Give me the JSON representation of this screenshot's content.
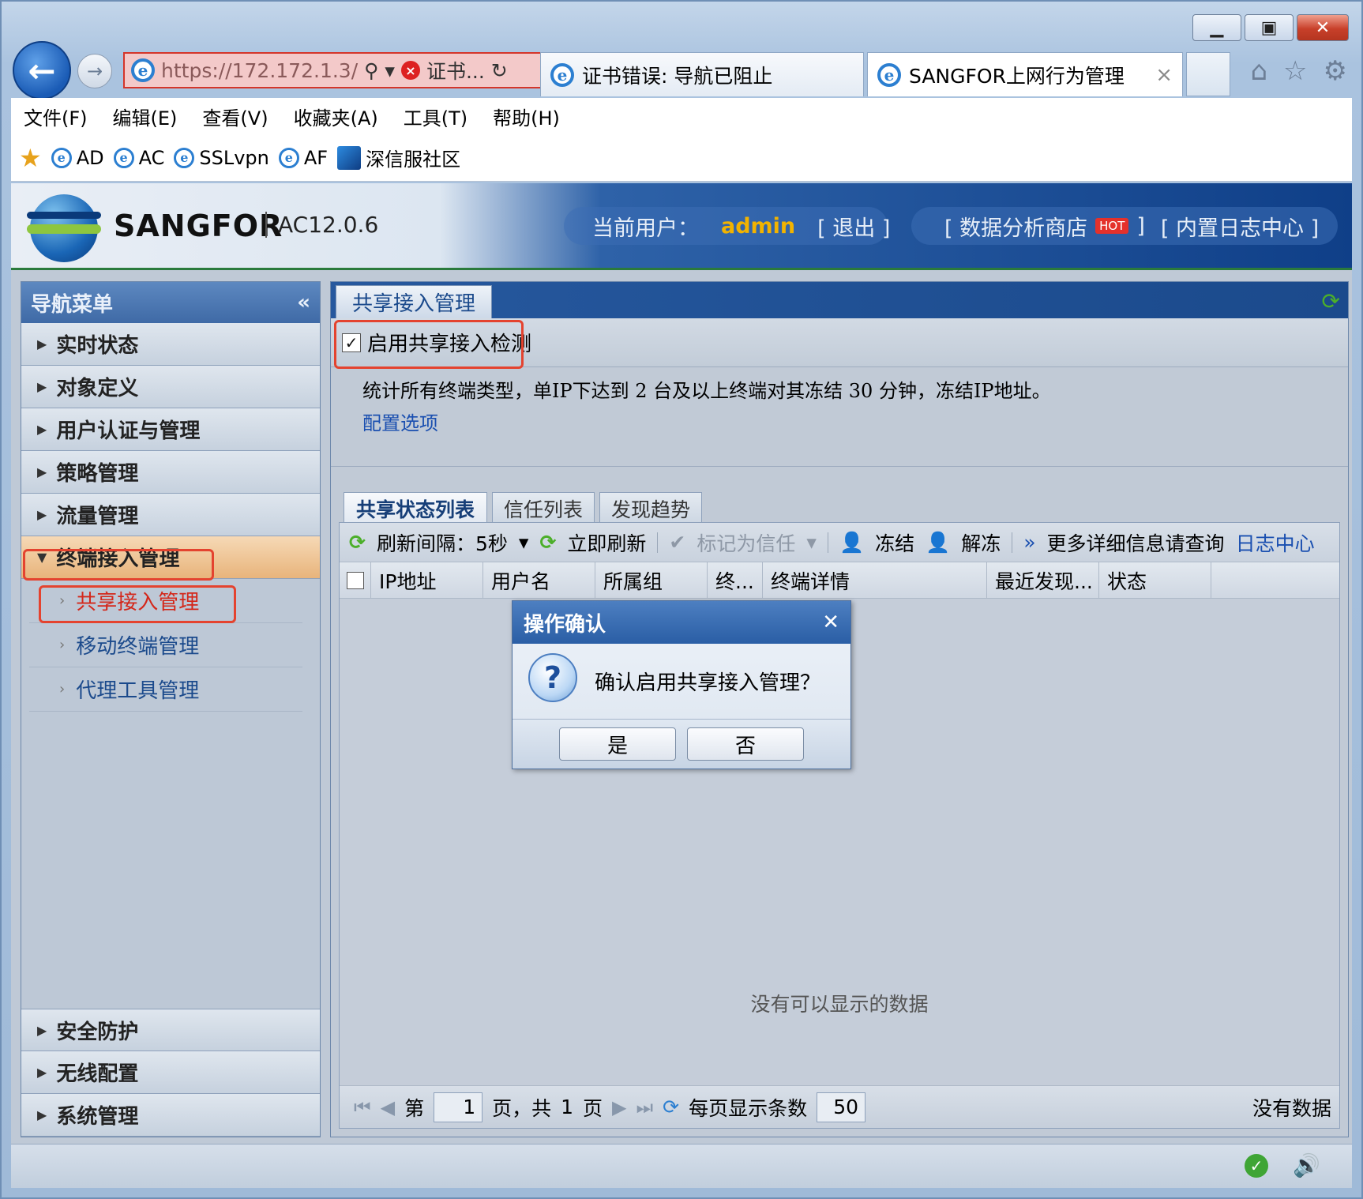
{
  "browser": {
    "address_url": "https://172.172.1.3/",
    "address_cert": "证书...",
    "tabs": [
      {
        "label": "证书错误: 导航已阻止"
      },
      {
        "label": "SANGFOR上网行为管理"
      }
    ],
    "menu": [
      "文件(F)",
      "编辑(E)",
      "查看(V)",
      "收藏夹(A)",
      "工具(T)",
      "帮助(H)"
    ],
    "favorites": [
      "AD",
      "AC",
      "SSLvpn",
      "AF",
      "深信服社区"
    ]
  },
  "header": {
    "brand": "SANGFOR",
    "version": "AC12.0.6",
    "current_user_label": "当前用户：",
    "username": "admin",
    "logout": "[ 退出 ]",
    "store": "[ 数据分析商店",
    "hot": "HOT",
    "store_close": "]",
    "log_center": "[ 内置日志中心 ]"
  },
  "sidebar": {
    "title": "导航菜单",
    "collapse": "«",
    "items_top": [
      "实时状态",
      "对象定义",
      "用户认证与管理",
      "策略管理",
      "流量管理"
    ],
    "active_item": "终端接入管理",
    "sub_items": [
      "共享接入管理",
      "移动终端管理",
      "代理工具管理"
    ],
    "items_bottom": [
      "安全防护",
      "无线配置",
      "系统管理"
    ]
  },
  "main": {
    "tab": "共享接入管理",
    "enable_label": "启用共享接入检测",
    "enable_checked": true,
    "description": "统计所有终端类型，单IP下达到 2 台及以上终端对其冻结 30 分钟，冻结IP地址。",
    "config_link": "配置选项",
    "subtabs": [
      "共享状态列表",
      "信任列表",
      "发现趋势"
    ],
    "toolbar": {
      "refresh_interval": "刷新间隔：5秒",
      "refresh_now": "立即刷新",
      "mark_trust": "标记为信任",
      "freeze": "冻结",
      "unfreeze": "解冻",
      "more": "更多详细信息请查询",
      "log_link": "日志中心"
    },
    "columns": [
      "IP地址",
      "用户名",
      "所属组",
      "终...",
      "终端详情",
      "最近发现...",
      "状态"
    ],
    "empty_text": "没有可以显示的数据",
    "pager": {
      "page_prefix": "第",
      "page_value": "1",
      "page_mid": "页，共",
      "total_pages": "1",
      "page_suffix": "页",
      "per_page_label": "每页显示条数",
      "per_page_value": "50",
      "no_data": "没有数据"
    }
  },
  "dialog": {
    "title": "操作确认",
    "message": "确认启用共享接入管理？",
    "yes": "是",
    "no": "否"
  },
  "colors": {
    "highlight_border": "#e4432f",
    "accent_blue": "#1b4a8c",
    "username": "#f2b300"
  }
}
